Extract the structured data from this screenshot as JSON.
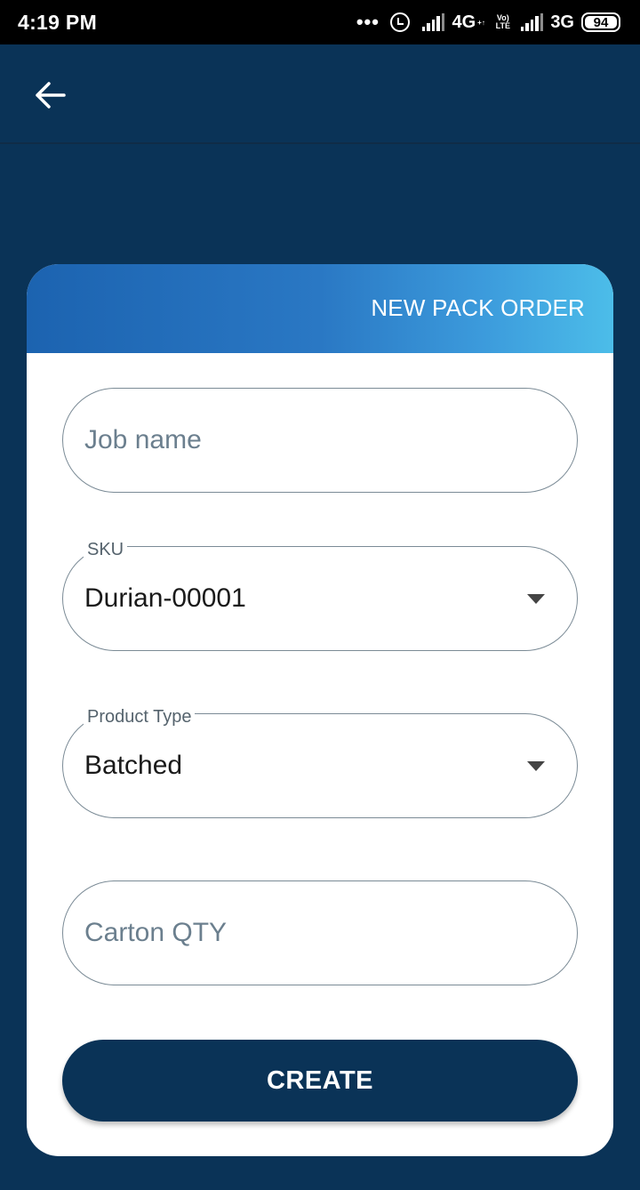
{
  "status_bar": {
    "time": "4:19 PM",
    "dots": "•••",
    "network_1": "4G",
    "network_1_sub": "+↑",
    "volte": "Vo) LTE",
    "network_2": "3G",
    "battery": "94"
  },
  "app_bar": {
    "back_icon": "arrow-left-icon"
  },
  "card": {
    "title": "NEW PACK ORDER",
    "job_name": {
      "placeholder": "Job name",
      "value": ""
    },
    "sku": {
      "label": "SKU",
      "value": "Durian-00001"
    },
    "product_type": {
      "label": "Product Type",
      "value": "Batched"
    },
    "carton_qty": {
      "placeholder": "Carton QTY",
      "value": ""
    },
    "create_label": "CREATE"
  },
  "colors": {
    "background": "#0a3357",
    "header_gradient_start": "#1c63b0",
    "header_gradient_end": "#4cbde9",
    "button": "#0a3357"
  }
}
